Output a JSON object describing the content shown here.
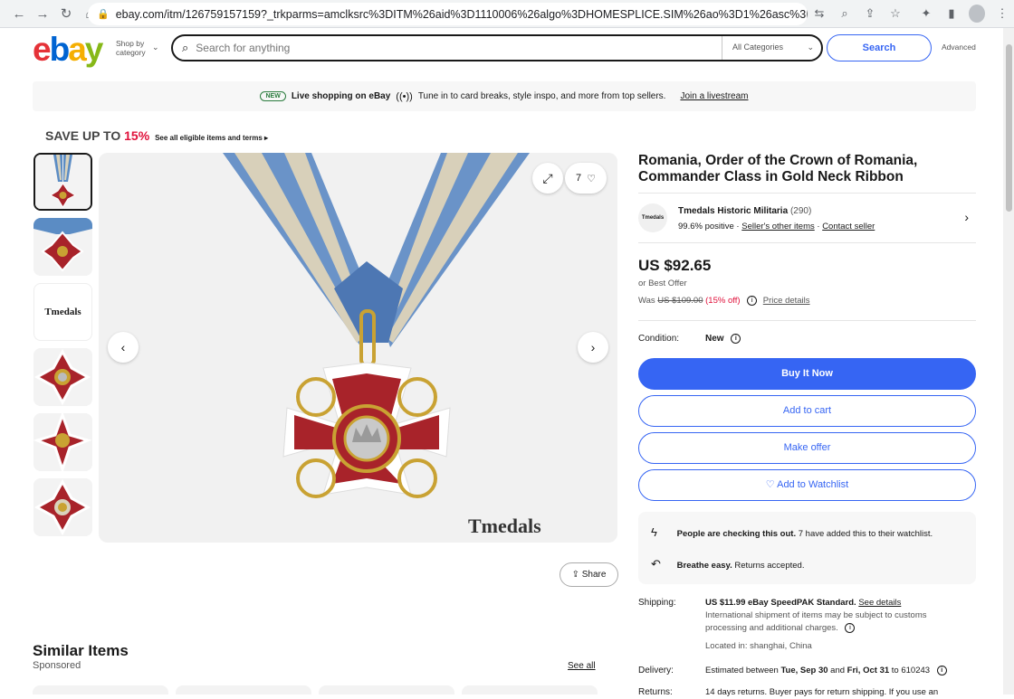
{
  "browser": {
    "url": "ebay.com/itm/126759157159?_trkparms=amclksrc%3DITM%26aid%3D1110006%26algo%3DHOMESPLICE.SIM%26ao%3D1%26asc%3D20231..."
  },
  "header": {
    "logo": {
      "e": "e",
      "b": "b",
      "a": "a",
      "y": "y"
    },
    "shop_by_line1": "Shop by",
    "shop_by_line2": "category",
    "search_placeholder": "Search for anything",
    "category": "All Categories",
    "search_button": "Search",
    "advanced": "Advanced"
  },
  "banner": {
    "badge": "NEW",
    "title": "Live shopping on eBay",
    "text": "Tune in to card breaks, style inspo, and more from top sellers.",
    "link": "Join a livestream"
  },
  "promo_strip": {
    "save_text": "SAVE UP TO",
    "percent": "15%",
    "link": "See all eligible items and terms ▸"
  },
  "gallery": {
    "watch_count": "7",
    "share": "Share",
    "watermark": "Tmedals",
    "thumb_logo": "Tmedals"
  },
  "similar": {
    "title": "Similar Items",
    "sponsored": "Sponsored",
    "see_all": "See all"
  },
  "item": {
    "title": "Romania, Order of the Crown of Romania, Commander Class in Gold Neck Ribbon",
    "seller": {
      "avatar_text": "Tmedals",
      "name": "Tmedals Historic Militaria",
      "count": "(290)",
      "positive": "99.6% positive",
      "other_items": "Seller's other items",
      "contact": "Contact seller"
    },
    "price": "US $92.65",
    "best_offer": "or Best Offer",
    "was_label": "Was",
    "was_price": "US $109.00",
    "discount": "(15% off)",
    "price_details": "Price details",
    "condition_label": "Condition:",
    "condition_value": "New",
    "buttons": {
      "buy": "Buy It Now",
      "cart": "Add to cart",
      "offer": "Make offer",
      "watch": "♡ Add to Watchlist"
    },
    "promo": {
      "checking_bold": "People are checking this out.",
      "checking_rest": "7 have added this to their watchlist.",
      "returns_bold": "Breathe easy.",
      "returns_rest": "Returns accepted."
    },
    "shipping": {
      "label": "Shipping:",
      "value": "US $11.99 eBay SpeedPAK Standard.",
      "link": "See details",
      "note1": "International shipment of items may be subject to customs",
      "note2": "processing and additional charges.",
      "location": "Located in: shanghai, China"
    },
    "delivery": {
      "label": "Delivery:",
      "prefix": "Estimated between",
      "start": "Tue, Sep 30",
      "and": "and",
      "end": "Fri, Oct 31",
      "suffix": "to 610243"
    },
    "returns": {
      "label": "Returns:",
      "value": "14 days returns. Buyer pays for return shipping. If you use an"
    }
  }
}
